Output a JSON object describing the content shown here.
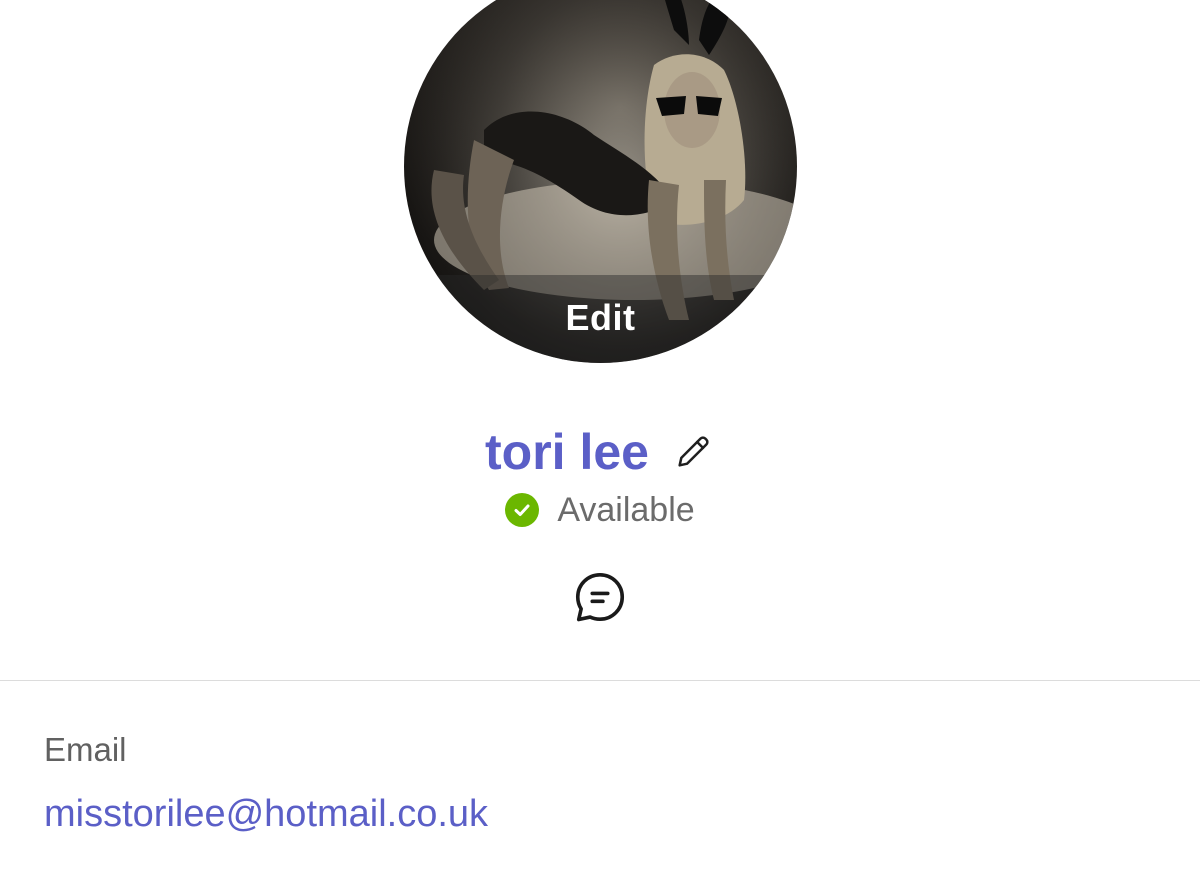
{
  "profile": {
    "avatar_edit_label": "Edit",
    "display_name": "tori lee",
    "status_text": "Available",
    "status_color": "#6bb700",
    "accent_color": "#5b5fc7"
  },
  "icons": {
    "edit_name": "pencil-icon",
    "status": "check-circle-icon",
    "chat": "chat-bubble-icon"
  },
  "contact": {
    "email_label": "Email",
    "email_value": "misstorilee@hotmail.co.uk"
  }
}
